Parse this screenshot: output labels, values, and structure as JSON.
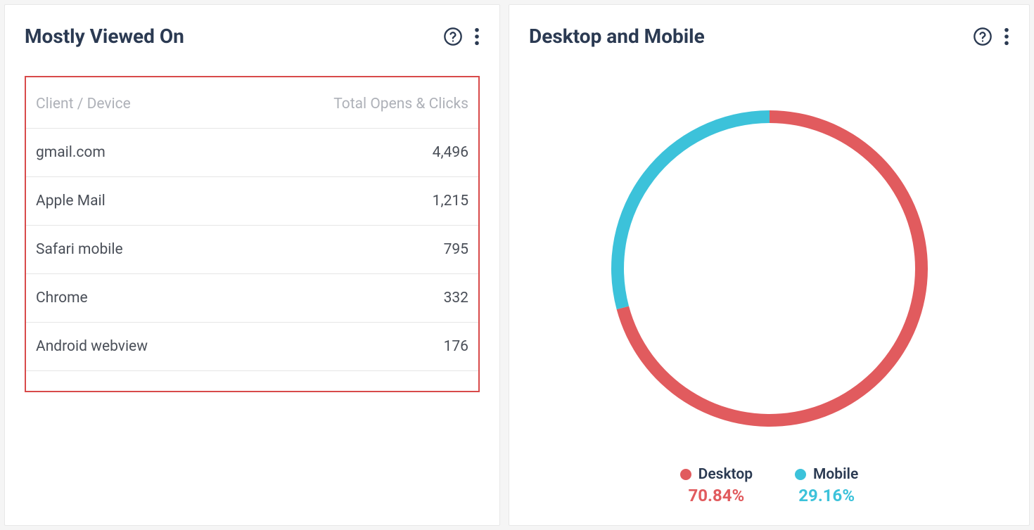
{
  "left_panel": {
    "title": "Mostly Viewed On",
    "table": {
      "col1": "Client / Device",
      "col2": "Total Opens & Clicks",
      "rows": [
        {
          "client": "gmail.com",
          "value": "4,496"
        },
        {
          "client": "Apple Mail",
          "value": "1,215"
        },
        {
          "client": "Safari mobile",
          "value": "795"
        },
        {
          "client": "Chrome",
          "value": "332"
        },
        {
          "client": "Android webview",
          "value": "176"
        }
      ]
    }
  },
  "right_panel": {
    "title": "Desktop and Mobile",
    "legend": {
      "desktop": {
        "label": "Desktop",
        "pct": "70.84%",
        "color": "#e15b5e"
      },
      "mobile": {
        "label": "Mobile",
        "pct": "29.16%",
        "color": "#3cc2da"
      }
    }
  },
  "colors": {
    "desktop": "#e15b5e",
    "mobile": "#3cc2da",
    "title": "#2b3a52"
  },
  "chart_data": {
    "type": "pie",
    "title": "Desktop and Mobile",
    "series": [
      {
        "name": "Desktop",
        "value": 70.84,
        "color": "#e15b5e"
      },
      {
        "name": "Mobile",
        "value": 29.16,
        "color": "#3cc2da"
      }
    ],
    "donut": true
  }
}
